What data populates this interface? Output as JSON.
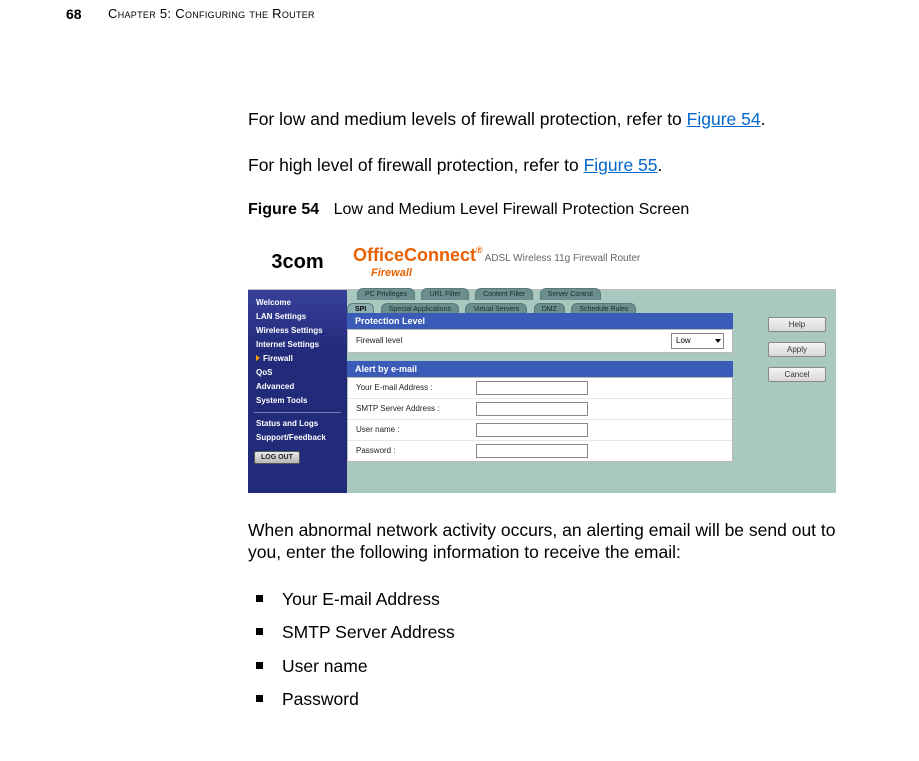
{
  "page_number": "68",
  "chapter_title": "Chapter 5: Configuring the Router",
  "para1_pre": "For low and medium levels of firewall protection, refer to ",
  "para1_link": "Figure 54",
  "para1_post": ".",
  "para2_pre": "For high level of firewall protection, refer to ",
  "para2_link": "Figure 55",
  "para2_post": ".",
  "figure": {
    "num": "Figure 54",
    "title": "Low and Medium Level Firewall Protection Screen"
  },
  "screenshot": {
    "logo": "3com",
    "brand": "OfficeConnect",
    "brand_reg": "®",
    "brand_sub": "ADSL Wireless 11g Firewall Router",
    "section": "Firewall",
    "sidebar": {
      "items": [
        "Welcome",
        "LAN Settings",
        "Wireless Settings",
        "Internet Settings",
        "Firewall",
        "QoS",
        "Advanced",
        "System Tools"
      ],
      "items2": [
        "Status and Logs",
        "Support/Feedback"
      ],
      "logout": "LOG OUT"
    },
    "tabs_top": [
      "PC Privileges",
      "URL Filter",
      "Content Filter",
      "Server Control"
    ],
    "tabs_bottom": [
      "SPI",
      "Special Applications",
      "Virtual Servers",
      "DMZ",
      "Schedule Rules"
    ],
    "panel1": {
      "header": "Protection Level",
      "label": "Firewall level",
      "value": "Low"
    },
    "panel2": {
      "header": "Alert by e-mail",
      "rows": [
        {
          "label": "Your E-mail Address :"
        },
        {
          "label": "SMTP Server Address :"
        },
        {
          "label": "User name :"
        },
        {
          "label": "Password :"
        }
      ]
    },
    "buttons": [
      "Help",
      "Apply",
      "Cancel"
    ]
  },
  "para3": "When abnormal network activity occurs, an alerting email will be send out to you, enter the following information to receive the email:",
  "bullets": [
    "Your E-mail Address",
    "SMTP Server Address",
    "User name",
    "Password"
  ]
}
